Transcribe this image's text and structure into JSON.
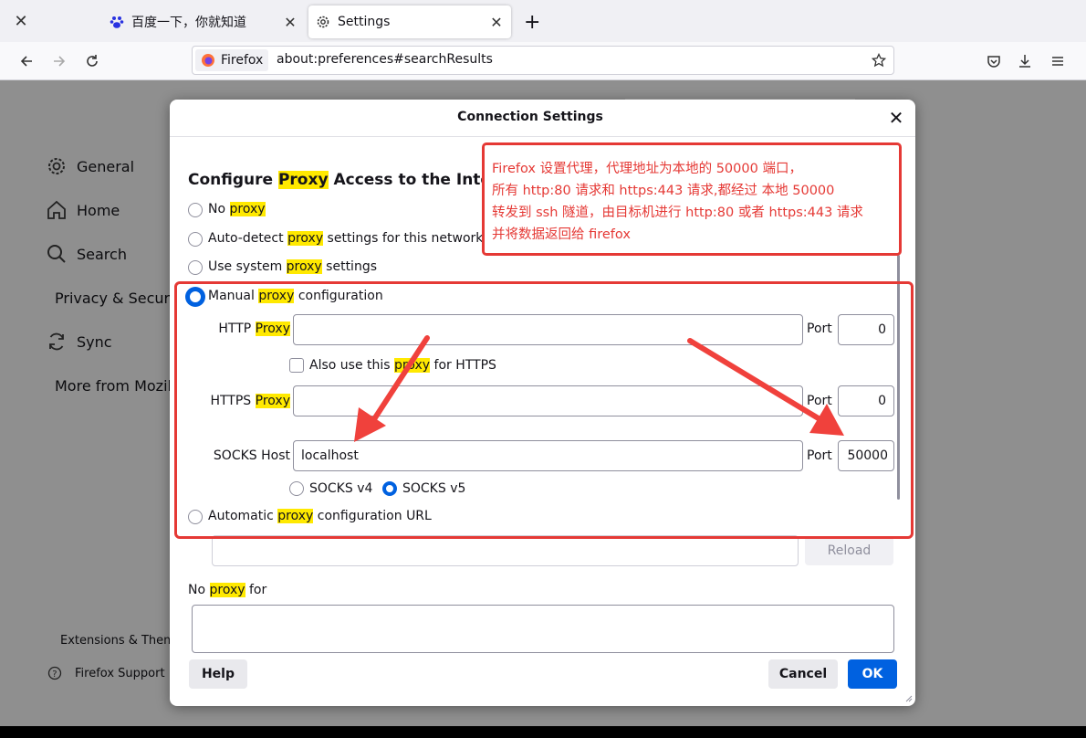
{
  "tabs": [
    {
      "label": "百度一下，你就知道"
    },
    {
      "label": "Settings"
    }
  ],
  "new_tab_label": "+",
  "tab_close_label": "✕",
  "urlbar": {
    "identity": "Firefox",
    "url": "about:preferences#searchResults"
  },
  "sidebar": {
    "items": [
      {
        "label": "General",
        "icon": "gear-icon"
      },
      {
        "label": "Home",
        "icon": "home-icon"
      },
      {
        "label": "Search",
        "icon": "search-icon"
      },
      {
        "label": "Privacy & Security",
        "icon": "lock-icon"
      },
      {
        "label": "Sync",
        "icon": "sync-icon"
      },
      {
        "label": "More from Mozilla",
        "icon": "mozilla-icon"
      }
    ],
    "footer": [
      {
        "label": "Extensions & Themes",
        "icon": "puzzle-icon"
      },
      {
        "label": "Firefox Support",
        "icon": "help-icon"
      }
    ]
  },
  "dialog": {
    "title": "Connection Settings",
    "close_label": "✕",
    "heading": {
      "pre": "Configure ",
      "hl": "Proxy",
      "post": " Access to the Internet"
    },
    "options": {
      "no_proxy": {
        "pre": "No ",
        "hl": "proxy",
        "post": ""
      },
      "auto_detect": {
        "pre": "Auto-detect ",
        "hl": "proxy",
        "post": " settings for this network"
      },
      "system": {
        "pre": "Use system ",
        "hl": "proxy",
        "post": " settings"
      },
      "manual": {
        "pre": "Manual ",
        "hl": "proxy",
        "post": " configuration"
      },
      "auto_url": {
        "pre": "Automatic ",
        "hl": "proxy",
        "post": " configuration URL"
      }
    },
    "selected_option": "manual",
    "http_proxy": {
      "label_pre": "HTTP ",
      "label_hl": "Proxy",
      "value": "",
      "port_label": "Port",
      "port": "0"
    },
    "also_https": {
      "pre": "Also use this ",
      "hl": "proxy",
      "post": " for HTTPS",
      "checked": false
    },
    "https_proxy": {
      "label_pre": "HTTPS ",
      "label_hl": "Proxy",
      "value": "",
      "port_label": "Port",
      "port": "0"
    },
    "socks": {
      "label": "SOCKS Host",
      "value": "localhost",
      "port_label": "Port",
      "port": "50000",
      "v4": "SOCKS v4",
      "v5": "SOCKS v5",
      "version": "v5"
    },
    "auto_url_value": "",
    "reload_label": "Reload",
    "no_proxy_for": {
      "pre": "No ",
      "hl": "proxy",
      "post": " for"
    },
    "no_proxy_value": "",
    "help_label": "Help",
    "cancel_label": "Cancel",
    "ok_label": "OK"
  },
  "annotation": {
    "lines": [
      "Firefox 设置代理，代理地址为本地的 50000 端口，",
      "所有 http:80 请求和 https:443 请求,都经过 本地 50000",
      "转发到 ssh 隧道，由目标机进行 http:80 或者 https:443 请求",
      "并将数据返回给 firefox"
    ],
    "color": "#e53935"
  },
  "colors": {
    "accent": "#0061e0",
    "highlight": "#ffe900",
    "annotation": "#e53935"
  }
}
